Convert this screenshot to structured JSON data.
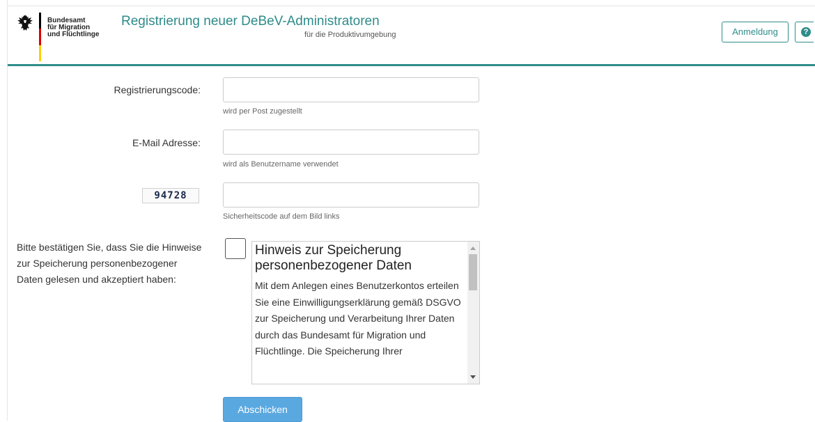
{
  "header": {
    "org_lines": [
      "Bundesamt",
      "für Migration",
      "und Flüchtlinge"
    ],
    "title": "Registrierung neuer DeBeV-Administratoren",
    "subtitle": "für die Produktivumgebung",
    "login_label": "Anmeldung",
    "help_glyph": "?",
    "eagle_icon": "federal-eagle-icon",
    "help_icon": "help-icon",
    "accent_color": "#2e8d8a",
    "flag_colors": [
      "#000000",
      "#dd0000",
      "#ffce00"
    ]
  },
  "form": {
    "registration_code": {
      "label": "Registrierungscode:",
      "value": "",
      "hint": "wird per Post zugestellt"
    },
    "email": {
      "label": "E-Mail Adresse:",
      "value": "",
      "hint": "wird als Benutzername verwendet"
    },
    "captcha": {
      "image_text": "94728",
      "value": "",
      "hint": "Sicherheitscode auf dem Bild links"
    },
    "consent": {
      "label": "Bitte bestätigen Sie, dass Sie die Hinweise zur Speicherung personenbezogener Daten gelesen und akzeptiert haben:",
      "checked": false
    },
    "notice": {
      "heading": "Hinweis zur Speicherung personenbezogener Daten",
      "body": "Mit dem Anlegen eines Benutzerkontos erteilen Sie eine Einwilligungserklärung gemäß DSGVO zur Speicherung und Verarbeitung Ihrer Daten durch das Bundesamt für Migration und Flüchtlinge. Die Speicherung Ihrer"
    },
    "submit_label": "Abschicken",
    "submit_color": "#5aa8e0"
  }
}
